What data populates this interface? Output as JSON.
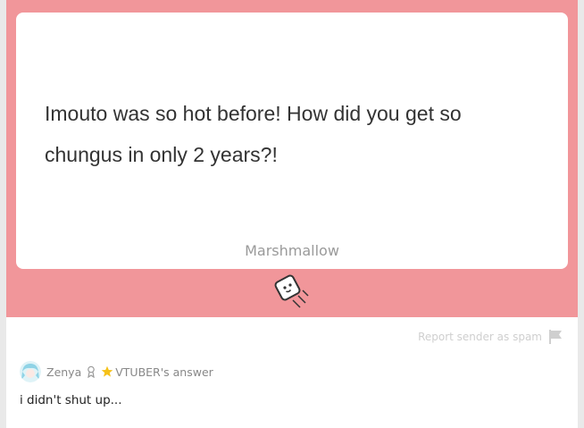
{
  "message": {
    "line1": "Imouto was so hot before! How did you get so",
    "line2": "chungus in only 2 years?!",
    "brand": "Marshmallow"
  },
  "report": {
    "label": "Report sender as spam"
  },
  "answer": {
    "name": "Zenya",
    "suffix": "VTUBER's answer",
    "text": "i didn't shut up..."
  },
  "colors": {
    "panel": "#f1969a",
    "star": "#f5c118",
    "report": "#cfcfcf"
  },
  "icons": {
    "mascot": "marshmallow-mascot-icon",
    "flag": "flag-icon",
    "ribbon": "ribbon-icon",
    "star": "star-icon"
  }
}
